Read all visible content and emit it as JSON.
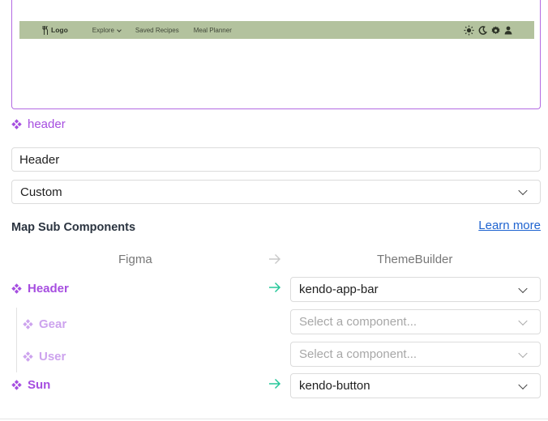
{
  "preview": {
    "logo": "Logo",
    "nav": [
      "Explore",
      "Saved Recipes",
      "Meal Planner"
    ],
    "icons": [
      "sun-icon",
      "moon-icon",
      "gear-icon",
      "user-icon"
    ]
  },
  "component_tag": "header",
  "name_input": {
    "value": "Header"
  },
  "type_select": {
    "value": "Custom"
  },
  "sub_components": {
    "title": "Map Sub Components",
    "learn_more": "Learn more",
    "col_figma": "Figma",
    "col_themebuilder": "ThemeBuilder",
    "rows": [
      {
        "label": "Header",
        "mapped": true,
        "value": "kendo-app-bar"
      },
      {
        "label": "Gear",
        "mapped": false,
        "placeholder": "Select a component..."
      },
      {
        "label": "User",
        "mapped": false,
        "placeholder": "Select a component..."
      },
      {
        "label": "Sun",
        "mapped": true,
        "value": "kendo-button"
      }
    ]
  },
  "colors": {
    "accent_purple": "#a64ee0",
    "muted_purple": "#cda3ee",
    "arrow_green": "#27c79a",
    "link_blue": "#1e63d0",
    "appbar_bg": "#b3c29e"
  }
}
